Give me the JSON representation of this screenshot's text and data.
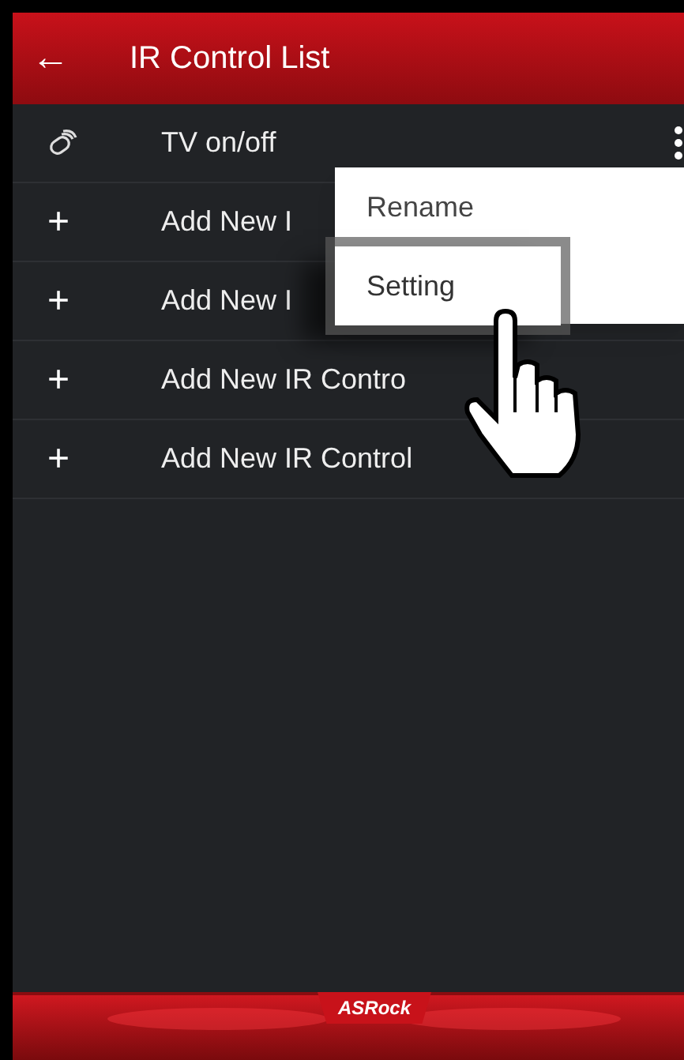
{
  "app_bar": {
    "back_icon": "←",
    "title": "IR Control List"
  },
  "rows": [
    {
      "kind": "remote",
      "label": "TV on/off"
    },
    {
      "kind": "add",
      "icon": "+",
      "label": "Add New I"
    },
    {
      "kind": "add",
      "icon": "+",
      "label": "Add New I"
    },
    {
      "kind": "add",
      "icon": "+",
      "label": "Add New IR Contro"
    },
    {
      "kind": "add",
      "icon": "+",
      "label": "Add New IR Control"
    }
  ],
  "menu": {
    "items": [
      {
        "label": "Rename",
        "selected": false
      },
      {
        "label": "Setting",
        "selected": true
      }
    ]
  },
  "footer": {
    "logo": "ASRock"
  }
}
